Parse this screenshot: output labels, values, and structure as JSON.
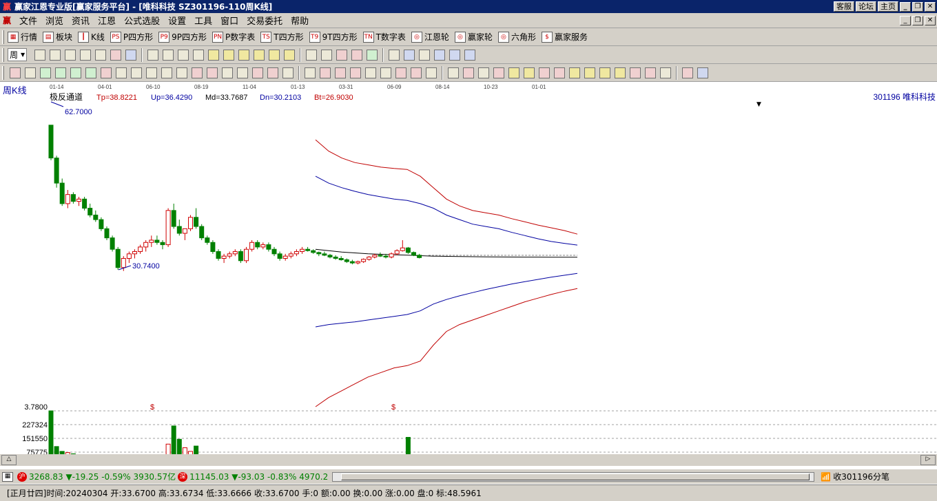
{
  "window": {
    "title": "赢家江恩专业版[赢家服务平台] - [唯科科技   SZ301196-110周K线]",
    "top_buttons": [
      "客服",
      "论坛",
      "主页"
    ]
  },
  "menu": [
    "文件",
    "浏览",
    "资讯",
    "江恩",
    "公式选股",
    "设置",
    "工具",
    "窗口",
    "交易委托",
    "帮助"
  ],
  "toolbar1": [
    {
      "label": "行情",
      "icon": "table-icon"
    },
    {
      "label": "板块",
      "icon": "blocks-icon"
    },
    {
      "label": "K线",
      "icon": "candles-icon"
    },
    {
      "label": "P四方形",
      "icon": "ps-icon",
      "tag": "PS"
    },
    {
      "label": "9P四方形",
      "icon": "p9-icon",
      "tag": "P9"
    },
    {
      "label": "P数字表",
      "icon": "pn-icon",
      "tag": "PN"
    },
    {
      "label": "T四方形",
      "icon": "ts-icon",
      "tag": "TS"
    },
    {
      "label": "9T四方形",
      "icon": "t9-icon",
      "tag": "T9"
    },
    {
      "label": "T数字表",
      "icon": "tn-icon",
      "tag": "TN"
    },
    {
      "label": "江恩轮",
      "icon": "gann-wheel-icon",
      "tag": "◎"
    },
    {
      "label": "赢家轮",
      "icon": "winner-wheel-icon",
      "tag": "◎"
    },
    {
      "label": "六角形",
      "icon": "hexagon-icon",
      "tag": "◎"
    },
    {
      "label": "赢家服务",
      "icon": "dollar-icon",
      "tag": "$"
    }
  ],
  "period_label": "周",
  "chart": {
    "period_title": "周K线",
    "indicator_name": "极反通道",
    "params": [
      {
        "text": "Tp=38.8221",
        "color": "#c00000"
      },
      {
        "text": "Up=36.4290",
        "color": "#0000a0"
      },
      {
        "text": "Md=33.7687",
        "color": "#000000"
      },
      {
        "text": "Dn=30.2103",
        "color": "#0000a0"
      },
      {
        "text": "Bt=26.9030",
        "color": "#c00000"
      }
    ],
    "stock_label": "301196  唯科科技",
    "high_label": "62.7000",
    "low_label": "30.7400",
    "date_ticks": [
      "01-14",
      "04-01",
      "06-10",
      "08-19",
      "11-04",
      "01-13",
      "03-31",
      "06-09",
      "08-14",
      "10-23",
      "01-01"
    ],
    "volume_axis": [
      "3.7800",
      "227324",
      "151550",
      "75775"
    ],
    "markers": [
      "$",
      "$"
    ]
  },
  "chart_data": {
    "type": "candlestick",
    "ohlc": [
      [
        62.7,
        62.7,
        55.0,
        55.5
      ],
      [
        55.5,
        56.0,
        49.0,
        50.0
      ],
      [
        50.0,
        51.0,
        45.0,
        45.5
      ],
      [
        45.5,
        48.5,
        44.5,
        47.5
      ],
      [
        47.5,
        48.0,
        45.5,
        46.0
      ],
      [
        46.0,
        47.0,
        45.0,
        46.5
      ],
      [
        46.5,
        47.0,
        44.0,
        44.5
      ],
      [
        44.5,
        45.5,
        42.5,
        43.0
      ],
      [
        43.0,
        44.0,
        41.5,
        42.0
      ],
      [
        42.0,
        42.5,
        39.5,
        40.0
      ],
      [
        40.0,
        40.5,
        37.5,
        38.0
      ],
      [
        38.0,
        38.5,
        35.0,
        35.5
      ],
      [
        35.5,
        36.0,
        31.0,
        31.5
      ],
      [
        31.5,
        34.0,
        30.74,
        33.5
      ],
      [
        33.5,
        35.0,
        32.5,
        34.5
      ],
      [
        34.5,
        35.5,
        33.5,
        35.0
      ],
      [
        35.0,
        36.5,
        34.5,
        36.0
      ],
      [
        36.0,
        37.5,
        35.0,
        37.0
      ],
      [
        37.0,
        38.5,
        36.0,
        37.5
      ],
      [
        37.5,
        38.5,
        36.5,
        37.0
      ],
      [
        37.0,
        37.5,
        35.5,
        36.5
      ],
      [
        36.5,
        44.5,
        36.0,
        44.0
      ],
      [
        44.0,
        45.5,
        40.0,
        40.5
      ],
      [
        40.5,
        42.0,
        38.5,
        39.0
      ],
      [
        39.0,
        40.0,
        37.5,
        40.0
      ],
      [
        40.0,
        43.0,
        39.5,
        42.5
      ],
      [
        42.5,
        44.5,
        40.0,
        40.5
      ],
      [
        40.5,
        41.0,
        37.5,
        38.0
      ],
      [
        38.0,
        38.5,
        36.5,
        37.0
      ],
      [
        37.0,
        37.5,
        34.5,
        35.0
      ],
      [
        35.0,
        35.5,
        33.0,
        33.5
      ],
      [
        33.5,
        34.5,
        32.5,
        34.0
      ],
      [
        34.0,
        35.0,
        33.5,
        34.5
      ],
      [
        34.5,
        35.5,
        34.0,
        35.0
      ],
      [
        35.0,
        35.5,
        32.5,
        33.0
      ],
      [
        33.0,
        36.0,
        32.5,
        35.5
      ],
      [
        35.5,
        37.5,
        35.0,
        37.0
      ],
      [
        37.0,
        37.5,
        35.5,
        36.0
      ],
      [
        36.0,
        37.0,
        35.5,
        36.5
      ],
      [
        36.5,
        37.0,
        35.0,
        35.5
      ],
      [
        35.5,
        36.0,
        34.0,
        34.5
      ],
      [
        34.5,
        35.0,
        33.0,
        33.5
      ],
      [
        33.5,
        34.5,
        33.0,
        34.0
      ],
      [
        34.0,
        35.0,
        33.5,
        34.5
      ],
      [
        34.5,
        35.5,
        34.0,
        35.0
      ],
      [
        35.0,
        36.0,
        34.5,
        35.5
      ],
      [
        35.5,
        36.0,
        35.0,
        35.2
      ],
      [
        35.2,
        35.5,
        34.5,
        34.8
      ],
      [
        34.8,
        35.0,
        34.0,
        34.5
      ],
      [
        34.5,
        35.0,
        34.0,
        34.2
      ],
      [
        34.2,
        34.5,
        33.5,
        33.8
      ],
      [
        33.8,
        34.2,
        33.2,
        33.5
      ],
      [
        33.5,
        34.0,
        33.0,
        33.2
      ],
      [
        33.2,
        33.5,
        32.5,
        32.8
      ],
      [
        32.8,
        33.2,
        32.2,
        32.5
      ],
      [
        32.5,
        33.0,
        32.2,
        32.8
      ],
      [
        32.8,
        33.5,
        32.5,
        33.3
      ],
      [
        33.3,
        34.0,
        33.0,
        33.8
      ],
      [
        33.8,
        34.5,
        33.5,
        34.2
      ],
      [
        34.2,
        34.8,
        33.8,
        34.0
      ],
      [
        34.0,
        34.5,
        33.5,
        33.8
      ],
      [
        33.8,
        34.8,
        33.5,
        34.5
      ],
      [
        34.5,
        35.5,
        34.2,
        35.2
      ],
      [
        35.2,
        37.5,
        35.0,
        35.8
      ],
      [
        35.8,
        36.0,
        34.5,
        34.8
      ],
      [
        34.8,
        35.0,
        34.0,
        34.2
      ],
      [
        34.2,
        34.5,
        33.5,
        33.67
      ]
    ],
    "volume": [
      227324,
      80000,
      60000,
      55000,
      50000,
      45000,
      42000,
      40000,
      38000,
      35000,
      32000,
      30000,
      25000,
      28000,
      22000,
      20000,
      22000,
      24000,
      26000,
      28000,
      25000,
      90000,
      165000,
      110000,
      75000,
      60000,
      82000,
      45000,
      20000,
      15000,
      12000,
      10000,
      9000,
      8000,
      10000,
      14000,
      45000,
      15000,
      12000,
      10000,
      9000,
      8000,
      9000,
      10000,
      11000,
      12000,
      10000,
      9000,
      8000,
      8000,
      7000,
      7000,
      6000,
      6000,
      6000,
      7000,
      8000,
      9000,
      10000,
      8000,
      8000,
      9000,
      35000,
      10000,
      118000,
      30000,
      15000
    ],
    "channel": {
      "top": [
        59.5,
        57.0,
        55.5,
        54.5,
        54.0,
        53.5,
        53.2,
        53.0,
        51.5,
        49.0,
        46.5,
        45.0,
        44.0,
        43.5,
        43.0,
        42.2,
        41.5,
        40.8,
        40.2,
        39.6,
        38.8221
      ],
      "up": [
        51.5,
        50.0,
        49.0,
        48.2,
        47.5,
        47.0,
        46.5,
        46.2,
        45.5,
        44.5,
        43.0,
        42.0,
        41.0,
        40.5,
        40.0,
        39.2,
        38.5,
        37.8,
        37.2,
        36.8,
        36.429
      ],
      "md": [
        35.5,
        35.2,
        34.9,
        34.7,
        34.5,
        34.4,
        34.3,
        34.2,
        34.1,
        34.0,
        33.95,
        33.9,
        33.88,
        33.85,
        33.82,
        33.8,
        33.79,
        33.78,
        33.77,
        33.77,
        33.7687
      ],
      "dn": [
        18.5,
        19.0,
        19.3,
        19.6,
        20.0,
        20.4,
        20.8,
        21.2,
        22.0,
        23.5,
        24.5,
        25.3,
        26.0,
        26.7,
        27.3,
        27.9,
        28.4,
        28.9,
        29.4,
        29.8,
        30.2103
      ],
      "bt": [
        1.0,
        3.0,
        4.5,
        6.0,
        7.5,
        8.5,
        9.5,
        10.0,
        11.0,
        14.5,
        17.5,
        19.0,
        20.0,
        21.0,
        22.0,
        23.0,
        24.0,
        24.8,
        25.6,
        26.3,
        26.903
      ]
    },
    "ylim": [
      1.0,
      66.0
    ],
    "volume_ylim": [
      0,
      227324
    ]
  },
  "status": {
    "sh_badge": "沪",
    "sh_index": "3268.83",
    "sh_change": "▼-19.25",
    "sh_pct": "-0.59%",
    "sh_amount": "3930.57亿",
    "sz_badge": "深",
    "sz_index": "11145.03",
    "sz_change": "▼-93.03",
    "sz_pct": "-0.83%",
    "sz_amount": "4970.2",
    "receive_text": "收301196分笔"
  },
  "status2": {
    "lunar": "[正月廿四]",
    "time": "时间:20240304",
    "open": "开:33.6700",
    "high": "高:33.6734",
    "low": "低:33.6666",
    "close": "收:33.6700",
    "hand": "手:0",
    "amount": "额:0.00",
    "turnover": "换:0.00",
    "rise": "涨:0.00",
    "pan": "盘:0",
    "mark": "标:48.5961"
  }
}
